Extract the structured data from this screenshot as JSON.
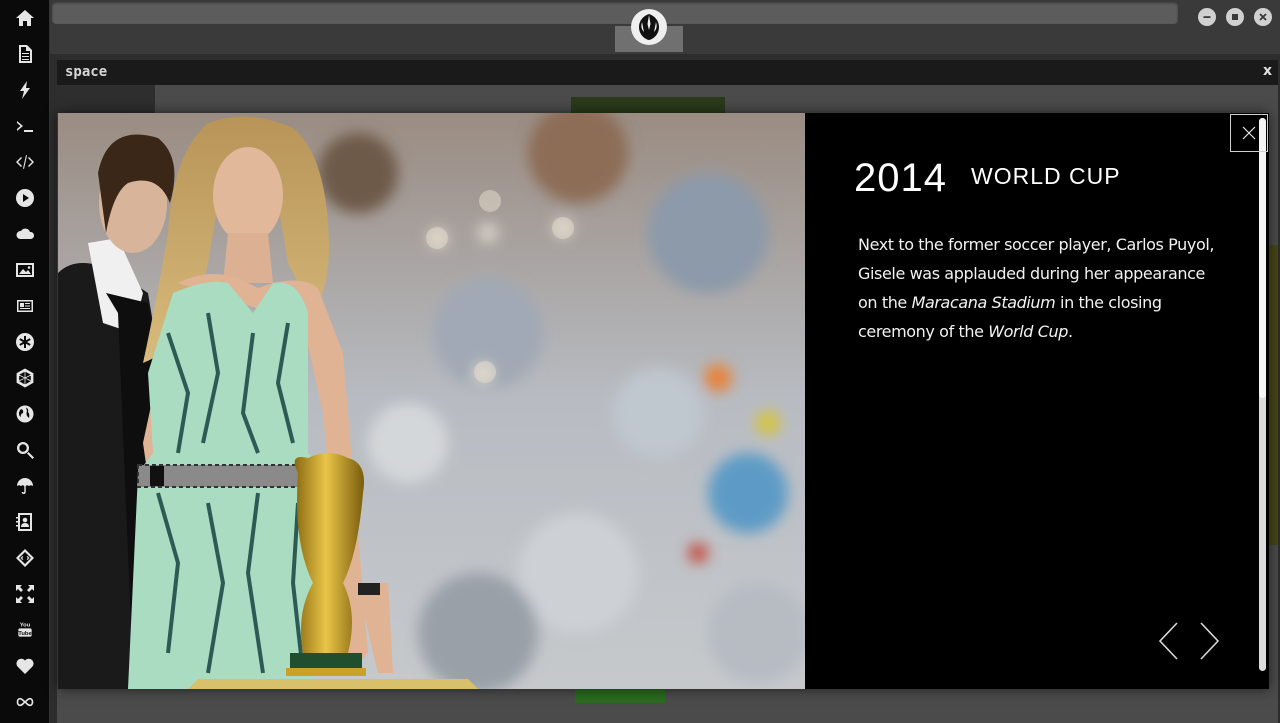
{
  "dock": {
    "icons": [
      "home-icon",
      "document-icon",
      "lightning-icon",
      "terminal-icon",
      "code-icon",
      "play-icon",
      "cloud-icon",
      "image-icon",
      "newspaper-icon",
      "asterisk-icon",
      "hexagon-icon",
      "globe-icon",
      "search-icon",
      "umbrella-icon",
      "contact-card-icon",
      "diamond-code-icon",
      "expand-icon",
      "youtube-icon",
      "heart-icon",
      "infinity-icon"
    ],
    "youtube_label": "You Tube"
  },
  "window": {
    "workspace_title": "space",
    "workspace_close": "x"
  },
  "lightbox": {
    "year": "2014",
    "event": "WORLD CUP",
    "caption": {
      "part1": "Next to the former soccer player, Carlos Puyol, Gisele was applauded during her appearance on the ",
      "place": "Maracana Stadium",
      "part2": " in the closing ceremony of the ",
      "event": "World Cup",
      "part3": "."
    }
  },
  "colors": {
    "dock_bg": "#0a0a0a",
    "lightbox_bg": "#000000",
    "dress": "#a9dcc0",
    "trophy": "#c9a227"
  }
}
